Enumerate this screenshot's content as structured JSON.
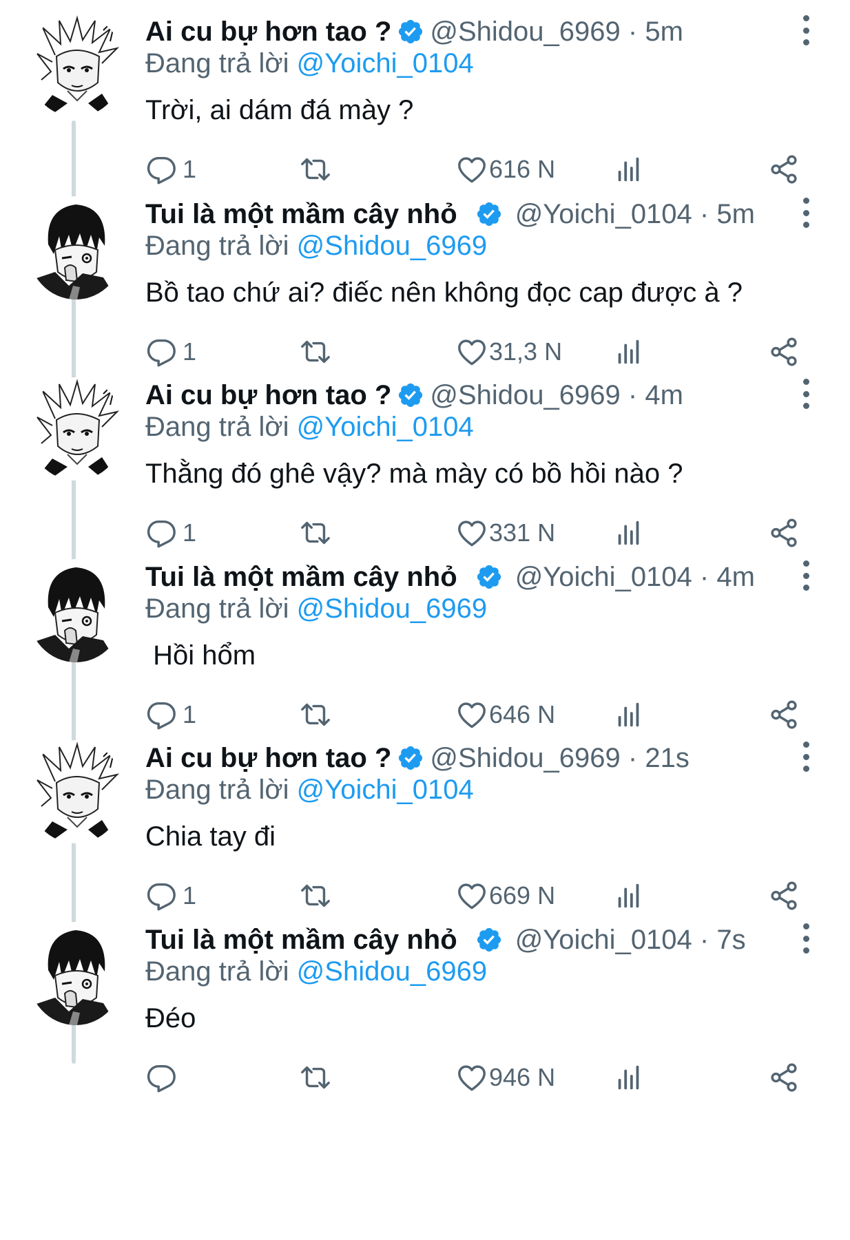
{
  "reply_prefix": "Đang trả lời",
  "icons": {
    "verified": "verified-badge-icon",
    "more": "more-options-icon",
    "reply": "reply-icon",
    "retweet": "retweet-icon",
    "like": "like-icon",
    "views": "views-icon",
    "share": "share-icon"
  },
  "colors": {
    "accent": "#1d9bf0",
    "secondary_text": "#536471",
    "thread_line": "#cfd9de"
  },
  "tweets": [
    {
      "display_name": "Ai cu bự hơn tao ?",
      "handle_meta": "@Shidou_6969 · 5m",
      "reply_to": "@Yoichi_0104",
      "text": "Trời, ai dám đá mày ?",
      "reply_count": "1",
      "like_count": "616 N",
      "avatar": "shidou-avatar"
    },
    {
      "display_name": "Tui là một mầm cây nhỏ",
      "handle_meta": "@Yoichi_0104 · 5m",
      "reply_to": "@Shidou_6969",
      "text": "Bồ tao chứ ai? điếc nên không đọc cap được à ?",
      "reply_count": "1",
      "like_count": "31,3 N",
      "avatar": "yoichi-avatar"
    },
    {
      "display_name": "Ai cu bự hơn tao ?",
      "handle_meta": "@Shidou_6969 · 4m",
      "reply_to": "@Yoichi_0104",
      "text": "Thằng đó ghê vậy? mà mày có bồ hồi nào ?",
      "reply_count": "1",
      "like_count": "331 N",
      "avatar": "shidou-avatar"
    },
    {
      "display_name": "Tui là một mầm cây nhỏ",
      "handle_meta": "@Yoichi_0104 · 4m",
      "reply_to": "@Shidou_6969",
      "text": " Hồi hổm",
      "reply_count": "1",
      "like_count": "646 N",
      "avatar": "yoichi-avatar"
    },
    {
      "display_name": "Ai cu bự hơn tao ?",
      "handle_meta": "@Shidou_6969 · 21s",
      "reply_to": "@Yoichi_0104",
      "text": "Chia tay đi",
      "reply_count": "1",
      "like_count": "669 N",
      "avatar": "shidou-avatar"
    },
    {
      "display_name": "Tui là một mầm cây nhỏ",
      "handle_meta": "@Yoichi_0104 · 7s",
      "reply_to": "@Shidou_6969",
      "text": "Đéo",
      "reply_count": "",
      "like_count": "946 N",
      "avatar": "yoichi-avatar"
    }
  ]
}
